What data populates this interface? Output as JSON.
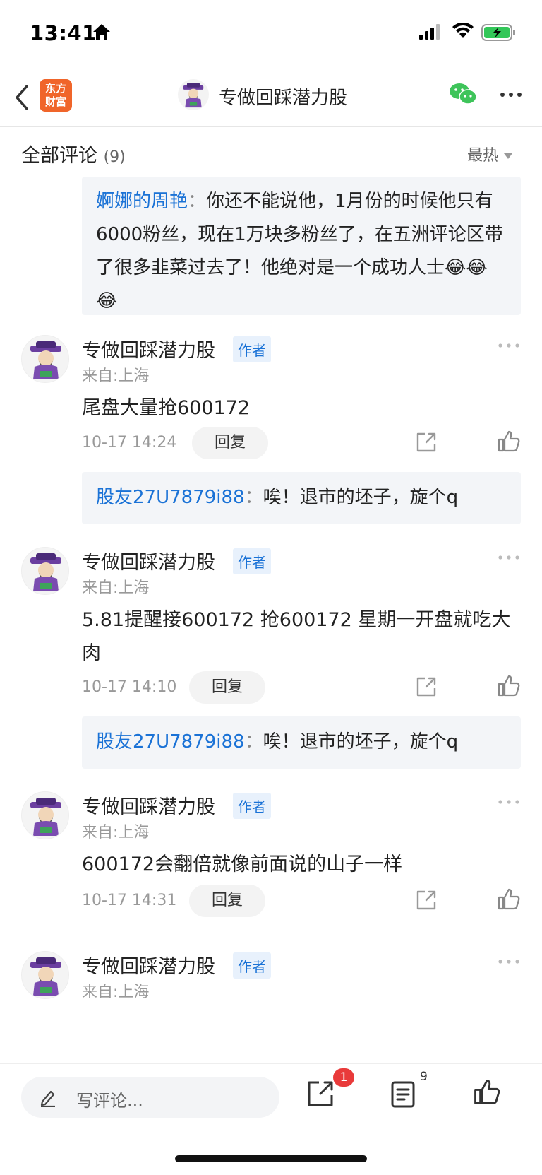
{
  "status_bar": {
    "time": "13:41",
    "battery_color": "#33c759"
  },
  "nav": {
    "logo_line1": "东方",
    "logo_line2": "财富",
    "title": "专做回踩潜力股",
    "brand_color": "#f0652a",
    "wechat_color": "#3ec45a"
  },
  "comments_header": {
    "label": "全部评论",
    "count": "(9)",
    "sort": "最热"
  },
  "top_quote": {
    "user": "婀娜的周艳",
    "colon": "：",
    "text": "你还不能说他，1月份的时候他只有6000粉丝，现在1万块多粉丝了，在五洲评论区带了很多韭菜过去了！他绝对是一个成功人士😂😂😂"
  },
  "comments": [
    {
      "name": "专做回踩潜力股",
      "tag": "作者",
      "location": "来自:上海",
      "text": "尾盘大量抢600172",
      "time": "10-17 14:24",
      "reply": "回复",
      "sub_reply": {
        "user": "股友27U7879i88",
        "colon": "：",
        "text": "唉！退市的坯子，旋个q"
      }
    },
    {
      "name": "专做回踩潜力股",
      "tag": "作者",
      "location": "来自:上海",
      "text": "5.81提醒接600172 抢600172 星期一开盘就吃大肉",
      "time": "10-17 14:10",
      "reply": "回复",
      "sub_reply": {
        "user": "股友27U7879i88",
        "colon": "：",
        "text": "唉！退市的坯子，旋个q"
      }
    },
    {
      "name": "专做回踩潜力股",
      "tag": "作者",
      "location": "来自:上海",
      "text": "600172会翻倍就像前面说的山子一样",
      "time": "10-17 14:31",
      "reply": "回复"
    },
    {
      "name": "专做回踩潜力股",
      "tag": "作者",
      "location": "来自:上海"
    }
  ],
  "toolbar": {
    "placeholder": "写评论...",
    "share_badge": "1",
    "comment_count": "9"
  },
  "colors": {
    "link": "#1a72d6",
    "badge": "#e93a3a",
    "quote_bg": "#f3f5f8"
  }
}
